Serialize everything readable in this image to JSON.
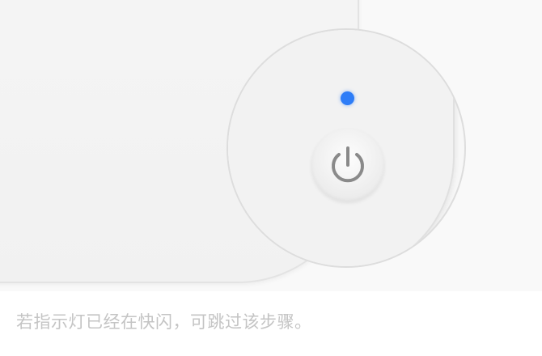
{
  "illustration": {
    "led_color": "#2e7df7",
    "power_icon": "power-icon"
  },
  "hint": {
    "text": "若指示灯已经在快闪，可跳过该步骤。"
  }
}
